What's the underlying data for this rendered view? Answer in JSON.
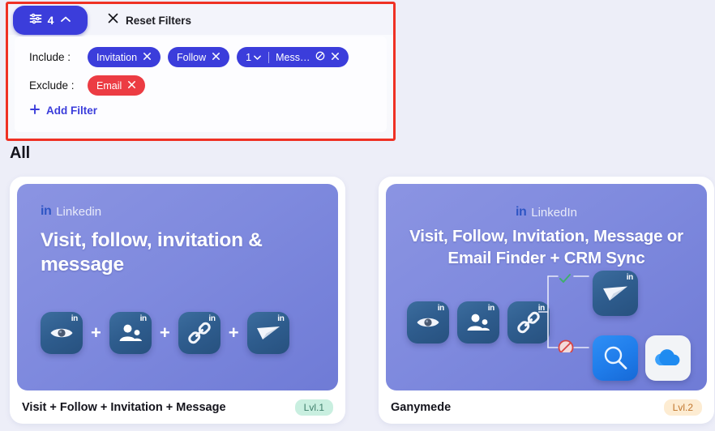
{
  "filter_panel": {
    "count_button": {
      "count": "4",
      "icon": "sliders-icon",
      "chevron": "chevron-up-icon"
    },
    "reset": {
      "label": "Reset Filters",
      "icon": "close-x-icon"
    },
    "include": {
      "label": "Include :",
      "chips": [
        {
          "text": "Invitation",
          "remove_icon": "close-x-icon"
        },
        {
          "text": "Follow",
          "remove_icon": "close-x-icon"
        },
        {
          "text": "Mess…",
          "count": "1",
          "dropdown_icon": "chevron-down-icon",
          "block_icon": "block-icon",
          "remove_icon": "close-x-icon"
        }
      ]
    },
    "exclude": {
      "label": "Exclude :",
      "chips": [
        {
          "text": "Email",
          "remove_icon": "close-x-icon"
        }
      ]
    },
    "add_filter": {
      "label": "Add Filter",
      "icon": "plus-icon"
    }
  },
  "section": {
    "title": "All"
  },
  "cards": [
    {
      "brand": "Linkedin",
      "brand_mark": "in",
      "headline": "Visit, follow, invitation & message",
      "title": "Visit + Follow + Invitation + Message",
      "level": "Lvl.1",
      "level_style": "lvl-1",
      "icons": [
        "eye-icon",
        "add-connection-icon",
        "link-icon",
        "send-message-icon"
      ],
      "separator": "+"
    },
    {
      "brand": "LinkedIn",
      "brand_mark": "in",
      "headline": "Visit, Follow, Invitation, Message or Email Finder + CRM Sync",
      "title": "Ganymede",
      "level": "Lvl.2",
      "level_style": "lvl-2",
      "icons": [
        "eye-icon",
        "add-connection-icon",
        "link-icon"
      ],
      "branch_icons": [
        "send-message-icon",
        "email-finder-search-icon",
        "crm-cloud-sync-icon"
      ],
      "branch_markers": [
        "accepted-check-icon",
        "blocked-icon"
      ]
    }
  ],
  "colors": {
    "accent_blue": "#3b3ddb",
    "accent_red": "#ec3c43",
    "highlight_border": "#ef3124",
    "page_bg": "#edeef8",
    "card_visual": "#7f8ade"
  }
}
